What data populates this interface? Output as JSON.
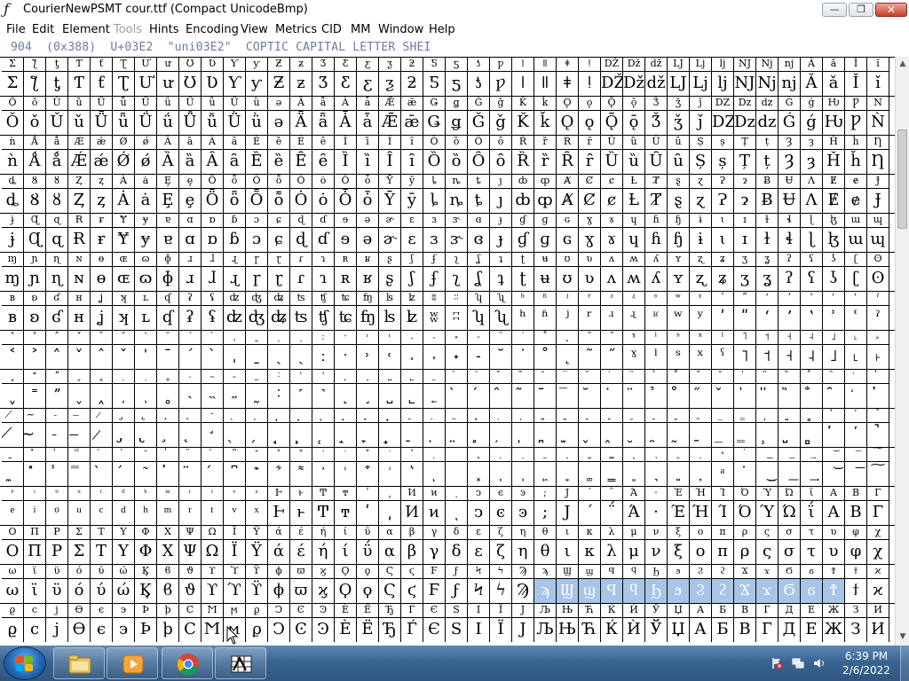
{
  "window": {
    "title": "CourierNewPSMT  cour.ttf (Compact UnicodeBmp)",
    "min_glyph": "—",
    "max_glyph": "❐",
    "close_glyph": "✕"
  },
  "menu": {
    "items": [
      {
        "label": "File",
        "enabled": true
      },
      {
        "label": "Edit",
        "enabled": true
      },
      {
        "label": "Element",
        "enabled": true
      },
      {
        "label": "Tools",
        "enabled": false
      },
      {
        "label": "Hints",
        "enabled": true
      },
      {
        "label": "Encoding",
        "enabled": true
      },
      {
        "label": "View",
        "enabled": true
      },
      {
        "label": "Metrics",
        "enabled": true
      },
      {
        "label": "CID",
        "enabled": true
      },
      {
        "label": "MM",
        "enabled": true
      },
      {
        "label": "Window",
        "enabled": true
      },
      {
        "label": "Help",
        "enabled": true
      }
    ]
  },
  "info": {
    "text": "904  (0x388)  U+03E2  \"uni03E2\"  COPTIC CAPITAL LETTER SHEI"
  },
  "glyph_grid": {
    "selection_color": "#a8c4e6",
    "rows": [
      "ƩƪƫƬƭƮƯưƱƲƳƴƵƶƷƸƹƺƻƼƽƾƿǀǁǂǃǄǅǆǇǈǉǊǋǌǍǎǏǐ",
      "ǑǒǓǔǕǖǗǘǙǚǛǜǝǞǟǠǡǢǣǤǥǦǧǨǩǪǫǬǭǮǯǰǱǲǳǴǵǶǷǸ",
      "ǹǺǻǼǽǾǿȀȁȂȃȄȅȆȇȈȉȊȋȌȍȎȏȐȑȒȓȔȕȖȗȘșȚțȜȝȞȟȠ",
      "ȡȢȣȤȥȦȧȨȩȪȫȬȭȮȯȰȱȲȳȴȵȶȷȸȹȺȻȼȽȾȿɀɁɂɃɄɅɆɇɈ",
      "ɉɊɋɌɍɎɏɐɑɒɓɔɕɖɗɘəɚɛɜɝɞɟɠɡɢɣɤɥɦɧɨɩɪɫɬɭɮɯɰ",
      "ɱɲɳɴɵɶɷɸɹɺɻɼɽɾɿʀʁʂʃʄʅʆʇʈʉʊʋʌʍʎʏʐʑʒʓʔʕʖʗʘ",
      "ʙʚʛʜʝʞʟʠʡʢʣʤʥʦʧʨʩʪʫʬʭʮʯʰʱʲʳʴʵʶʷʸʹʺʻʼʽʾʿˀ",
      "˂˃˄˅ˆˇˈˉˊˋˌˍˎˏːˑ˒˓˔˕˖˗˘˙˚˛˜˝ˠˡˢˣˤ˥˦˧˨˩˪˫",
      "ˬ˭ˮ˯˰˱˲˳˴˵˶˷˸˹˺˻˼˽˾˿̀́̂̃̄̅̆̇̈̉̊̋̌̍̎̏̐̑̒̓",
      "̸̴̵̶̷̡̢̧̨̛̖̗̘̙̜̝̞̟̠̣̤̥̦̩̪̫̬̭̮̯̰̱̲̳̹̺̻̔̕̚",
      "̼̽̾̿̀́͂̓̈́͆͊͋͌͐͑͒͗͛ͅ͏͓͔͕͖͙͚͇͈͉͍͎ͣ͘͜͟͢͝͞͠͡",
      "ͤͥͦͧͨͩͪͫͬͭͮͯͰͱͲͳʹ͵Ͷͷͺͻͼͽ;Ϳ΄΅Ά·ΈΉΊΌΎΏΐΑΒΓΔΕΖΗΘΙΚΛΜΝΞ",
      "ΟΠΡΣΤΥΦΧΨΩΪΫάέήίΰαβγδεζηθικλμνξοπρςστυφχψ",
      "ωϊϋόύώϏϐϑϒϓϔϕϖϗϘϙϚϛϜϝϞϟϠϡϢϣϤϥϦϧϨϩϪϫϬϭϮϯϰ",
      "ϱϲϳϴϵ϶ϷϸϹϺϻϼϽϾϿЀЁЂЃЄЅІЇЈЉЊЋЌЍЎЏАБВГДЕЖЗИ"
    ],
    "selected": {
      "row": 13,
      "start": 24,
      "end": 37
    }
  },
  "taskbar": {
    "buttons": [
      {
        "name": "explorer-taskbar-button",
        "icon": "folder-icon"
      },
      {
        "name": "media-player-taskbar-button",
        "icon": "media-player-icon"
      },
      {
        "name": "chrome-taskbar-button",
        "icon": "chrome-icon"
      },
      {
        "name": "fontforge-taskbar-button",
        "icon": "fontforge-icon"
      }
    ],
    "clock": {
      "time": "6:39 PM",
      "date": "2/6/2022"
    }
  }
}
